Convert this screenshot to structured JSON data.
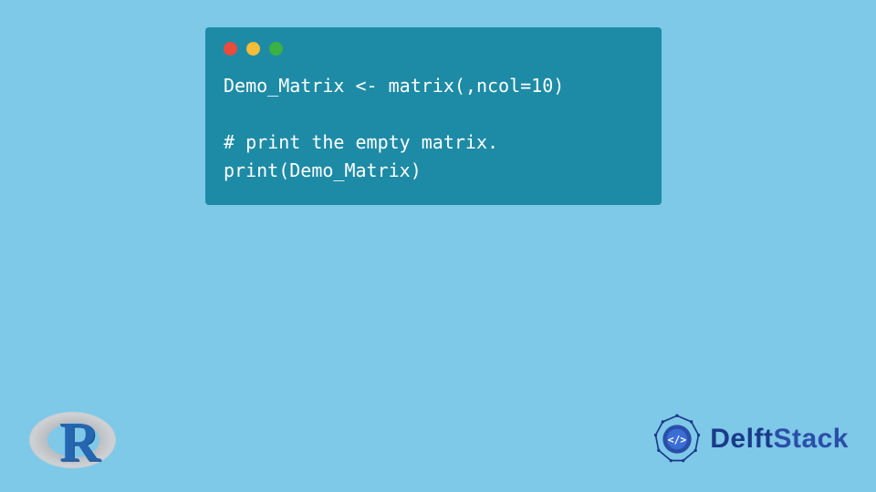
{
  "code": {
    "line1": "Demo_Matrix <- matrix(,ncol=10)",
    "line2": "",
    "line3": "# print the empty matrix.",
    "line4": "print(Demo_Matrix)"
  },
  "r_logo_letter": "R",
  "brand": {
    "part1": "Delft",
    "part2": "Stack"
  },
  "colors": {
    "bg": "#7ec8e8",
    "window": "#1d8ba6",
    "red": "#e94b3c",
    "yellow": "#f5bd38",
    "green": "#3bb143"
  }
}
